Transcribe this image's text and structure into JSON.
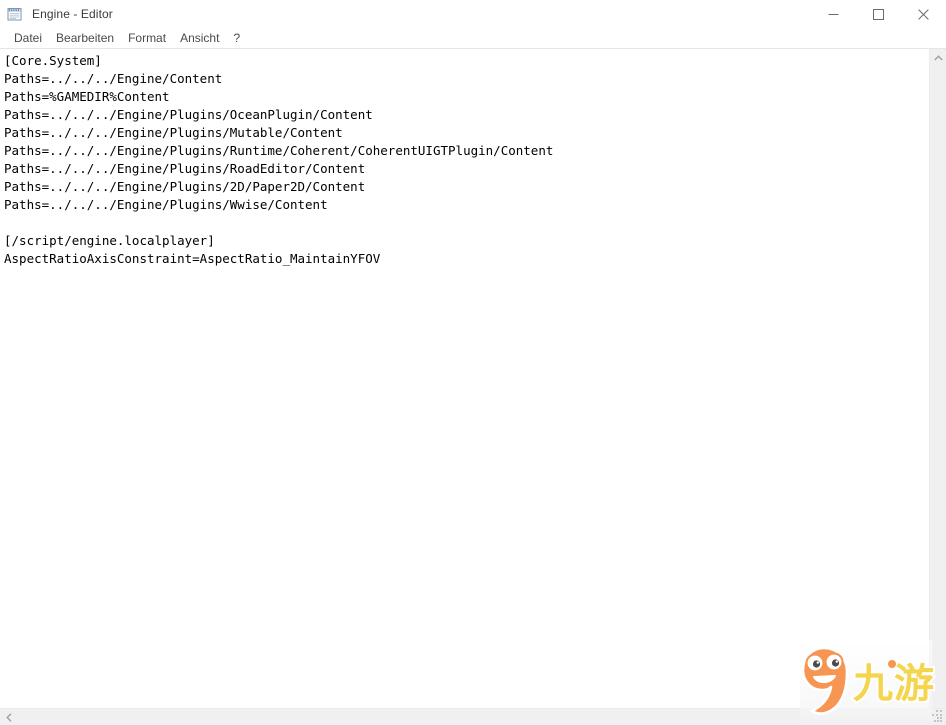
{
  "window": {
    "title": "Engine - Editor",
    "icon": "notepad-icon",
    "controls": {
      "minimize_label": "Minimieren",
      "maximize_label": "Maximieren",
      "close_label": "Schließen"
    }
  },
  "menubar": {
    "items": [
      {
        "label": "Datei"
      },
      {
        "label": "Bearbeiten"
      },
      {
        "label": "Format"
      },
      {
        "label": "Ansicht"
      },
      {
        "label": "?"
      }
    ]
  },
  "editor": {
    "lines": [
      "[Core.System]",
      "Paths=../../../Engine/Content",
      "Paths=%GAMEDIR%Content",
      "Paths=../../../Engine/Plugins/OceanPlugin/Content",
      "Paths=../../../Engine/Plugins/Mutable/Content",
      "Paths=../../../Engine/Plugins/Runtime/Coherent/CoherentUIGTPlugin/Content",
      "Paths=../../../Engine/Plugins/RoadEditor/Content",
      "Paths=../../../Engine/Plugins/2D/Paper2D/Content",
      "Paths=../../../Engine/Plugins/Wwise/Content",
      "",
      "[/script/engine.localplayer]",
      "AspectRatioAxisConstraint=AspectRatio_MaintainYFOV"
    ],
    "text": "[Core.System]\nPaths=../../../Engine/Content\nPaths=%GAMEDIR%Content\nPaths=../../../Engine/Plugins/OceanPlugin/Content\nPaths=../../../Engine/Plugins/Mutable/Content\nPaths=../../../Engine/Plugins/Runtime/Coherent/CoherentUIGTPlugin/Content\nPaths=../../../Engine/Plugins/RoadEditor/Content\nPaths=../../../Engine/Plugins/2D/Paper2D/Content\nPaths=../../../Engine/Plugins/Wwise/Content\n\n[/script/engine.localplayer]\nAspectRatioAxisConstraint=AspectRatio_MaintainYFOV"
  },
  "scrollbars": {
    "vertical": {
      "up_arrow": "chevron-up-icon",
      "down_arrow": "chevron-down-icon"
    },
    "horizontal": {
      "left_arrow": "chevron-left-icon"
    }
  },
  "watermark": {
    "text": "九游",
    "colors": {
      "mascot": "#F79552",
      "characters": "#F5D44E",
      "outline": "#FFFFFF"
    }
  },
  "colors": {
    "titlebar_bg": "#FFFFFF",
    "text_fg": "#000000",
    "menu_fg": "#4A4A4A",
    "scrollbar_bg": "#F0F0F0"
  }
}
